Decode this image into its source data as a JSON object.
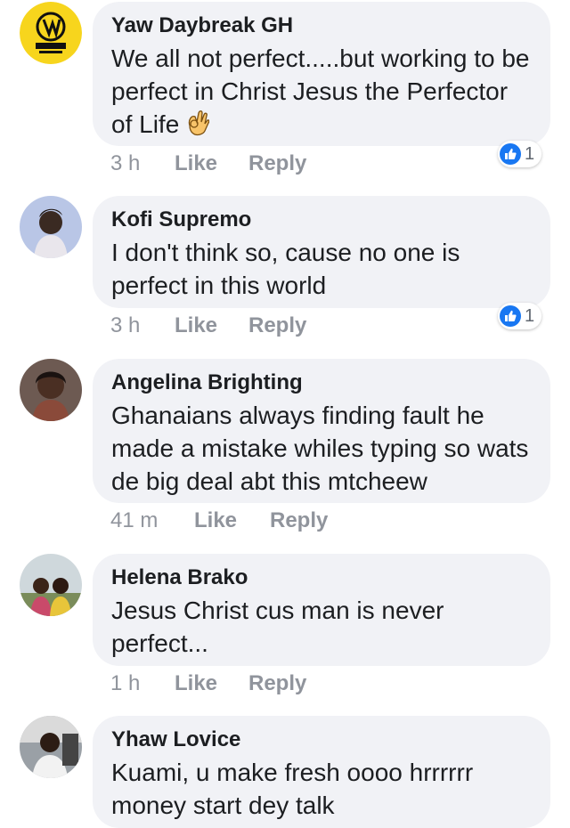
{
  "comments": [
    {
      "author": "Yaw Daybreak GH",
      "text": "We all not perfect.....but working to be perfect in Christ Jesus the Perfector of Life",
      "emoji": "ok-hand-emoji",
      "time": "3 h",
      "like_label": "Like",
      "reply_label": "Reply",
      "reaction_count": "1",
      "avatar": "logo-avatar-yellow"
    },
    {
      "author": "Kofi Supremo",
      "text": "I don't think so, cause no one is perfect in this world",
      "time": "3 h",
      "like_label": "Like",
      "reply_label": "Reply",
      "reaction_count": "1",
      "avatar": "photo-avatar-blue"
    },
    {
      "author": "Angelina Brighting",
      "text": "Ghanaians always finding fault he made a mistake whiles typing so wats de big deal abt this mtcheew",
      "time": "41 m",
      "like_label": "Like",
      "reply_label": "Reply",
      "avatar": "photo-avatar-dark"
    },
    {
      "author": "Helena Brako",
      "text": "Jesus Christ cus man is never perfect...",
      "time": "1 h",
      "like_label": "Like",
      "reply_label": "Reply",
      "avatar": "photo-avatar-outdoor"
    },
    {
      "author": "Yhaw Lovice",
      "text": "Kuami, u make fresh oooo hrrrrrr money start dey talk",
      "avatar": "photo-avatar-grey"
    }
  ],
  "colors": {
    "bubble": "#f1f2f6",
    "like_blue": "#1877f2",
    "meta_grey": "#90949c",
    "avatar_logo_yellow": "#f7d51d"
  }
}
